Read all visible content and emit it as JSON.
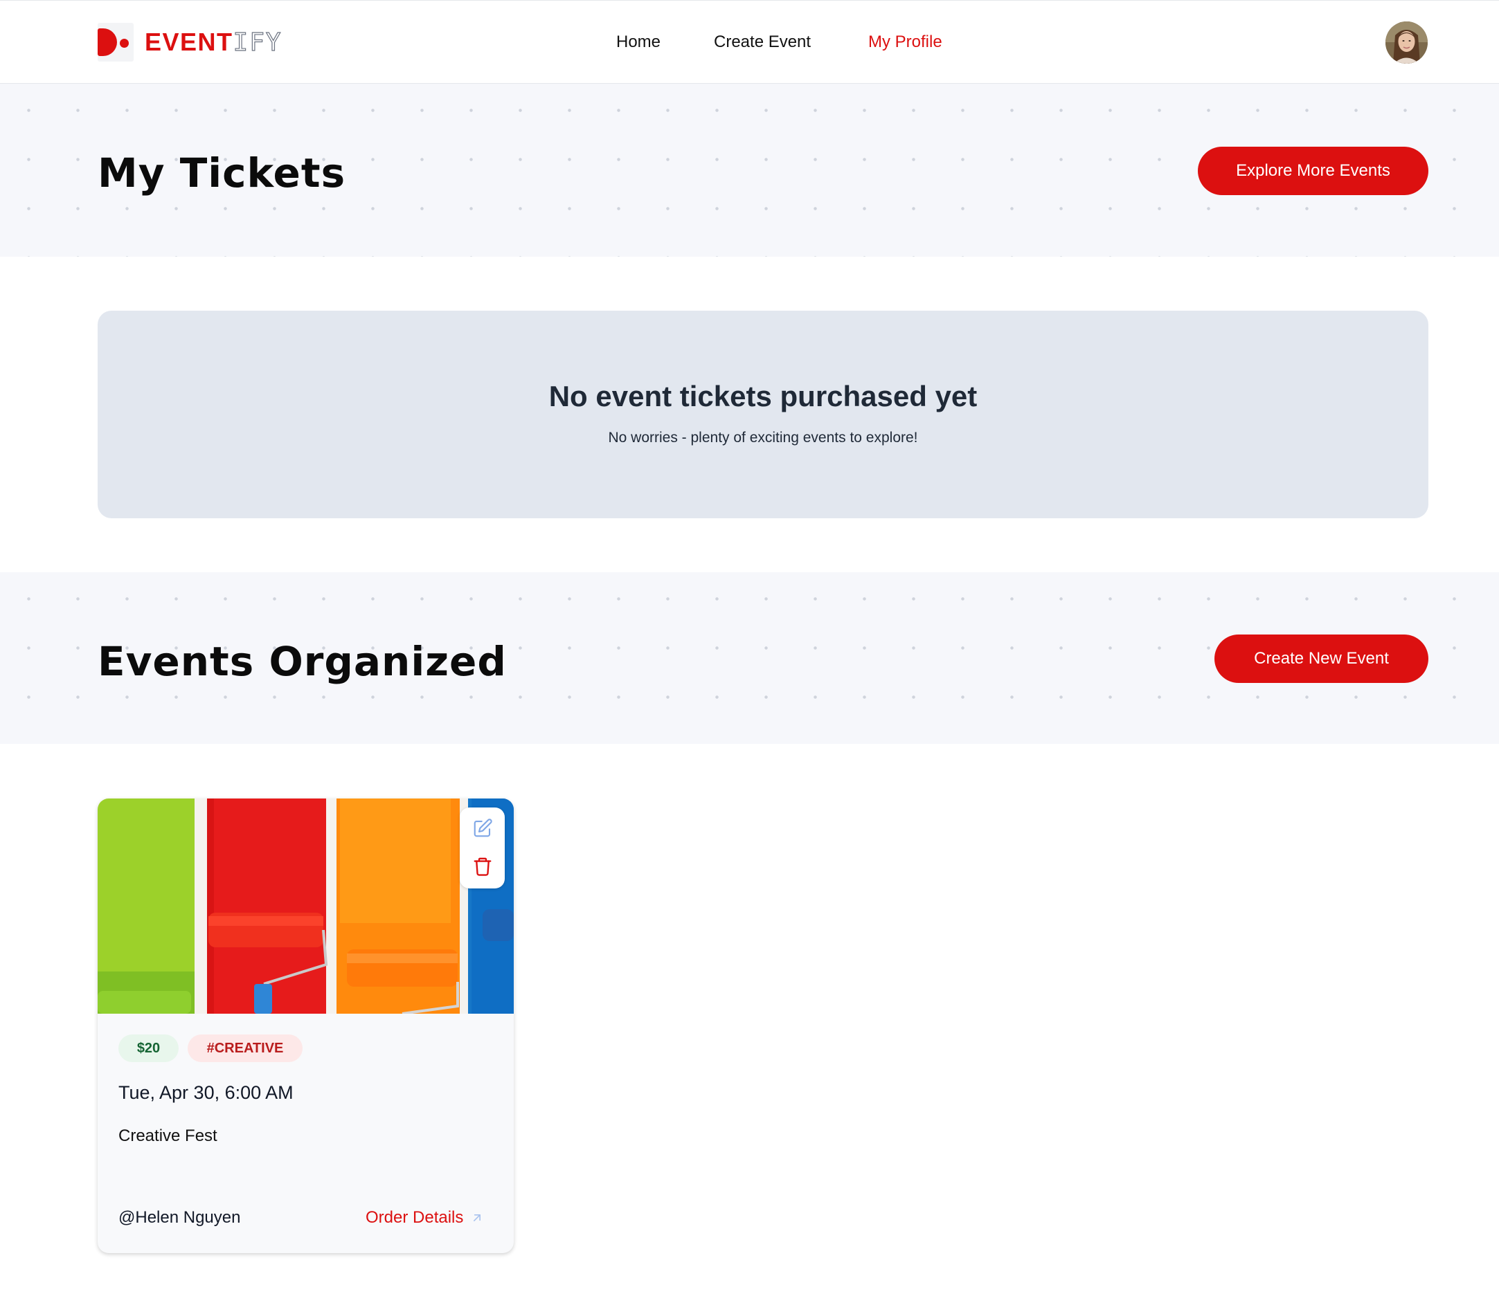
{
  "brand": {
    "name_bold": "EVENT",
    "name_outline": "IFY",
    "color": "#dc1010"
  },
  "nav": {
    "items": [
      {
        "label": "Home",
        "active": false
      },
      {
        "label": "Create Event",
        "active": false
      },
      {
        "label": "My Profile",
        "active": true
      }
    ]
  },
  "user": {
    "avatar_icon": "user-avatar"
  },
  "tickets_section": {
    "title": "My Tickets",
    "action_label": "Explore More Events",
    "empty_title": "No event tickets purchased yet",
    "empty_subtitle": "No worries - plenty of exciting events to explore!"
  },
  "organized_section": {
    "title": "Events Organized",
    "action_label": "Create New Event",
    "events": [
      {
        "price": "$20",
        "tag": "#CREATIVE",
        "date": "Tue, Apr 30, 6:00 AM",
        "title": "Creative Fest",
        "organizer": "@Helen Nguyen",
        "link_label": "Order Details",
        "image_icon": "paint-rollers-image",
        "edit_icon": "edit-icon",
        "delete_icon": "trash-icon"
      }
    ]
  },
  "colors": {
    "accent": "#dc1010",
    "band_bg": "#f6f7fb",
    "empty_bg": "#e2e7ef",
    "price_badge_bg": "#e8f6ec",
    "tag_badge_bg": "#fde8e8"
  }
}
